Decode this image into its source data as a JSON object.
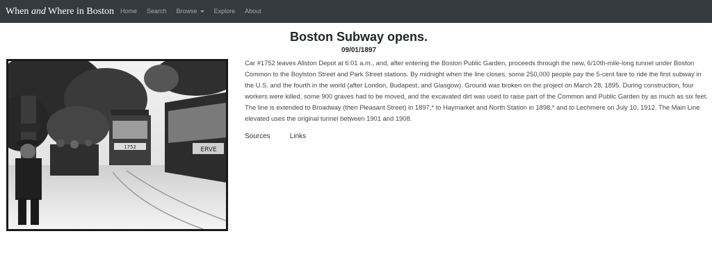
{
  "navbar": {
    "brand_pre": "When ",
    "brand_em": "and",
    "brand_post": " Where in Boston",
    "links": {
      "home": "Home",
      "search": "Search",
      "browse": "Browse",
      "explore": "Explore",
      "about": "About"
    }
  },
  "event": {
    "title": "Boston Subway opens.",
    "date": "09/01/1897",
    "description": "Car #1752 leaves Allston Depot at 6:01 a.m., and, after entering the Boston Public Garden, proceeds through the new, 6/10th-mile-long tunnel under Boston Common to the Boylston Street and Park Street stations. By midnight when the line closes, some 250,000 people pay the 5-cent fare to ride the first subway in the U.S. and the fourth in the world (after London, Budapest, and Glasgow). Ground was broken on the project on March 28, 1895. During construction, four workers were killed, some 900 graves had to be moved, and the excavated dirt was used to raise part of the Common and Public Garden by as much as six feet. The line is extended to Broadway (then Pleasant Street) in 1897,* to Haymarket and North Station in 1898,* and to Lechmere on July 10, 1912. The Main Line elevated uses the original tunnel between 1901 and 1908."
  },
  "tabs": {
    "sources": "Sources",
    "links": "Links"
  },
  "photo": {
    "streetcar_sign_left": "1752",
    "streetcar_sign_right": "ERVE"
  }
}
